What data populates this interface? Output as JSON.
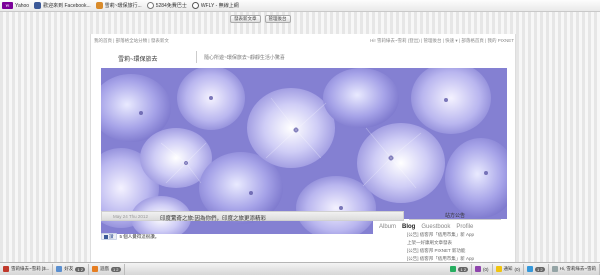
{
  "bookmarks": [
    {
      "icon": "yahoo-icon",
      "label": "Yahoo",
      "badge": "Y!"
    },
    {
      "icon": "facebook-icon",
      "label": "歡迎來到 Facebook..."
    },
    {
      "icon": "blog-icon",
      "label": "雪莉~環保旅行..."
    },
    {
      "icon": "ttl-icon",
      "label": "5284免費巴士"
    },
    {
      "icon": "wfly-icon",
      "label": "WFLY - 無線上網"
    }
  ],
  "topbar": {
    "btn1": "發表新文章",
    "btn2": "管理後台"
  },
  "nav": {
    "left": "我的首頁 | 部落格全站分類 | 發表新文",
    "right": "Hi! 雪莉綠去~雪莉 (登出) | 管理後台 | 快速 ▾ | 部落格首頁 | 我的 PIXNET"
  },
  "blog": {
    "title": "雪莉~環保旅去",
    "description": "隨心所遊~環保旅去~靜靜生活小驚喜"
  },
  "tabs": [
    {
      "label": "Album",
      "active": false
    },
    {
      "label": "Blog",
      "active": true
    },
    {
      "label": "Guestbook",
      "active": false
    },
    {
      "label": "Profile",
      "active": false
    }
  ],
  "article": {
    "date": "May 24 Thu 2012",
    "title": "印度驚奇之旅:因為你們，印度之旅更添精彩"
  },
  "like": {
    "button": "讚",
    "count_text": "5 個人覺得這很讚。"
  },
  "sidebar": {
    "heading": "站方公告",
    "items": [
      "[公告] 痞客邦「痞用市集」新 App",
      "上架一好康刷文章發表",
      "[公告] 痞客邦 PIXNET 新功能",
      "[公告] 痞客邦「痞用市集」新 App"
    ]
  },
  "taskbar": {
    "items": [
      {
        "icon": "browser-icon",
        "label": "雪莉綠去~雪莉 [$..."
      },
      {
        "icon": "friends-icon",
        "label": "好友",
        "badge": "1 2"
      },
      {
        "icon": "games-icon",
        "label": "遊戲",
        "badge": "1 2"
      },
      {
        "icon": "chat-icon",
        "label": "",
        "badge": "1 2"
      },
      {
        "icon": "notify-icon",
        "label": "",
        "badge": "(0)"
      },
      {
        "icon": "alert-icon",
        "label": "通知",
        "badge": "(0)"
      },
      {
        "icon": "mail-icon",
        "label": "",
        "badge": "1 2"
      },
      {
        "icon": "user-icon",
        "label": "Hi, 雪莉綠去~雪莉"
      }
    ]
  },
  "colors": {
    "facebook": "#3b5998",
    "yahoo": "#7b0099",
    "hydrangea": "#8a86d6"
  }
}
